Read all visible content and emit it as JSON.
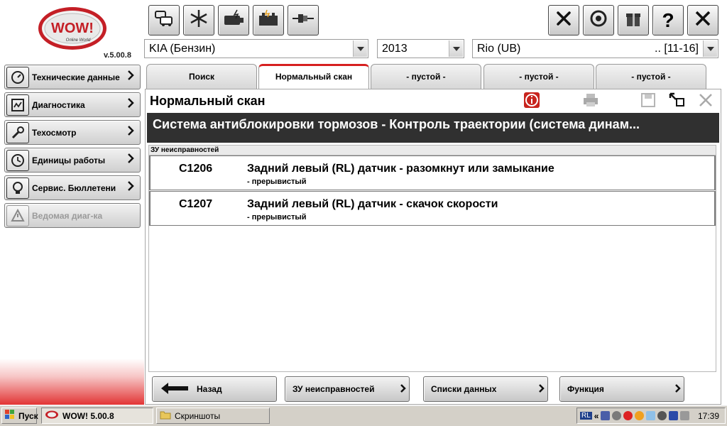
{
  "app": {
    "logo_text": "WOW!",
    "logo_tagline": "Online World",
    "version": "v.5.00.8"
  },
  "toolbar_left": [
    {
      "name": "traffic-icon"
    },
    {
      "name": "snowflake-icon"
    },
    {
      "name": "engine-icon"
    },
    {
      "name": "battery-icon"
    },
    {
      "name": "plug-icon"
    }
  ],
  "toolbar_right": [
    {
      "name": "tools-icon"
    },
    {
      "name": "clock-icon"
    },
    {
      "name": "gift-icon"
    },
    {
      "name": "help-icon",
      "label": "?"
    },
    {
      "name": "close-icon"
    }
  ],
  "selectors": {
    "make": "KIA (Бензин)",
    "year": "2013",
    "model": "Rio (UB)",
    "model_range": ".. [11-16]"
  },
  "tabs": [
    {
      "label": "Поиск",
      "active": false
    },
    {
      "label": "Нормальный скан",
      "active": true
    },
    {
      "label": "- пустой -",
      "active": false
    },
    {
      "label": "- пустой -",
      "active": false
    },
    {
      "label": "- пустой -",
      "active": false
    }
  ],
  "sidebar": {
    "items": [
      {
        "label": "Технические данные",
        "icon": "gauge-icon",
        "enabled": true
      },
      {
        "label": "Диагностика",
        "icon": "diagnostic-icon",
        "enabled": true
      },
      {
        "label": "Техосмотр",
        "icon": "wrench-icon",
        "enabled": true
      },
      {
        "label": "Единицы работы",
        "icon": "clock-icon",
        "enabled": true
      },
      {
        "label": "Сервис. Бюллетени",
        "icon": "lightbulb-icon",
        "enabled": true
      },
      {
        "label": "Ведомая диаг-ка",
        "icon": "warning-icon",
        "enabled": false
      }
    ]
  },
  "panel": {
    "title": "Нормальный скан",
    "system": "Система антиблокировки тормозов - Контроль траектории (система динам...",
    "dtc_header": "ЗУ неисправностей",
    "dtcs": [
      {
        "code": "C1206",
        "description": "Задний левый (RL) датчик - разомкнут или замыкание",
        "status": "- прерывистый"
      },
      {
        "code": "C1207",
        "description": "Задний левый (RL) датчик - скачок скорости",
        "status": "- прерывистый"
      }
    ]
  },
  "bottom_buttons": {
    "back": "Назад",
    "fault_memory": "ЗУ неисправностей",
    "data_lists": "Списки данных",
    "function": "Функция"
  },
  "taskbar": {
    "start": "Пуск",
    "items": [
      {
        "label": "WOW! 5.00.8",
        "pressed": true
      },
      {
        "label": "Скриншоты",
        "pressed": false
      }
    ],
    "tray_lang": "RL",
    "clock": "17:39"
  },
  "colors": {
    "accent_red": "#d62020",
    "system_bar": "#303030",
    "info_icon": "#c8241e"
  }
}
